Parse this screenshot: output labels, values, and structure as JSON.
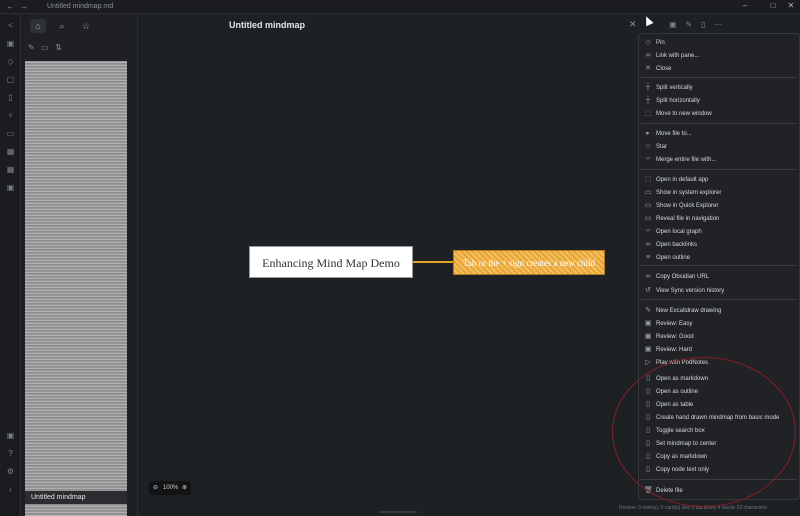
{
  "window": {
    "title": "Untitled mindmap.md"
  },
  "main": {
    "title": "Untitled mindmap",
    "zoom_level": "100%"
  },
  "mindmap": {
    "root": "Enhancing Mind Map Demo",
    "child": "Tab or the + sign creates a new child"
  },
  "filelist": {
    "current": "Untitled mindmap"
  },
  "status": {
    "text": "Review: 0 note(s), 0 card(s) due    0 backlinks    4 words    33 characters"
  },
  "menu": {
    "items": [
      {
        "icon": "pin-icon",
        "glyph": "◇",
        "label": "Pin"
      },
      {
        "icon": "link-icon",
        "glyph": "∞",
        "label": "Link with pane..."
      },
      {
        "icon": "close-icon",
        "glyph": "✕",
        "label": "Close"
      },
      {
        "icon": "split-vertical-icon",
        "glyph": "┼",
        "label": "Split vertically"
      },
      {
        "icon": "split-horizontal-icon",
        "glyph": "┼",
        "label": "Split horizontally"
      },
      {
        "icon": "new-window-icon",
        "glyph": "⬚",
        "label": "Move to new window"
      },
      {
        "icon": "move-file-icon",
        "glyph": "▸",
        "label": "Move file to..."
      },
      {
        "icon": "star-icon",
        "glyph": "☆",
        "label": "Star"
      },
      {
        "icon": "merge-icon",
        "glyph": "⑂",
        "label": "Merge entire file with..."
      },
      {
        "icon": "open-app-icon",
        "glyph": "⬚",
        "label": "Open in default app"
      },
      {
        "icon": "explorer-icon",
        "glyph": "▭",
        "label": "Show in system explorer"
      },
      {
        "icon": "folder-icon",
        "glyph": "▭",
        "label": "Show in Quick Explorer"
      },
      {
        "icon": "reveal-icon",
        "glyph": "▭",
        "label": "Reveal file in navigation"
      },
      {
        "icon": "graph-icon",
        "glyph": "⑂",
        "label": "Open local graph"
      },
      {
        "icon": "backlinks-icon",
        "glyph": "∞",
        "label": "Open backlinks"
      },
      {
        "icon": "outline-icon",
        "glyph": "≡",
        "label": "Open outline"
      },
      {
        "icon": "url-icon",
        "glyph": "∞",
        "label": "Copy Obsidian URL"
      },
      {
        "icon": "history-icon",
        "glyph": "↺",
        "label": "View Sync version history"
      },
      {
        "icon": "excalidraw-icon",
        "glyph": "✎",
        "label": "New Excalidraw drawing"
      },
      {
        "icon": "review-icon",
        "glyph": "▣",
        "label": "Review: Easy"
      },
      {
        "icon": "review-icon",
        "glyph": "▣",
        "label": "Review: Good"
      },
      {
        "icon": "review-icon",
        "glyph": "▣",
        "label": "Review: Hard"
      },
      {
        "icon": "play-icon",
        "glyph": "▷",
        "label": "Play with PodNotes"
      },
      {
        "icon": "file-icon",
        "glyph": "▯",
        "label": "Open as markdown"
      },
      {
        "icon": "file-icon",
        "glyph": "▯",
        "label": "Open as outline"
      },
      {
        "icon": "file-icon",
        "glyph": "▯",
        "label": "Open as table"
      },
      {
        "icon": "file-icon",
        "glyph": "▯",
        "label": "Create hand drawn mindmap from basic mode"
      },
      {
        "icon": "file-icon",
        "glyph": "▯",
        "label": "Toggle search box"
      },
      {
        "icon": "file-icon",
        "glyph": "▯",
        "label": "Set mindmap to center"
      },
      {
        "icon": "file-icon",
        "glyph": "▯",
        "label": "Copy as markdown"
      },
      {
        "icon": "file-icon",
        "glyph": "▯",
        "label": "Copy node text only"
      },
      {
        "icon": "trash-icon",
        "glyph": "🗑",
        "label": "Delete file"
      }
    ]
  }
}
